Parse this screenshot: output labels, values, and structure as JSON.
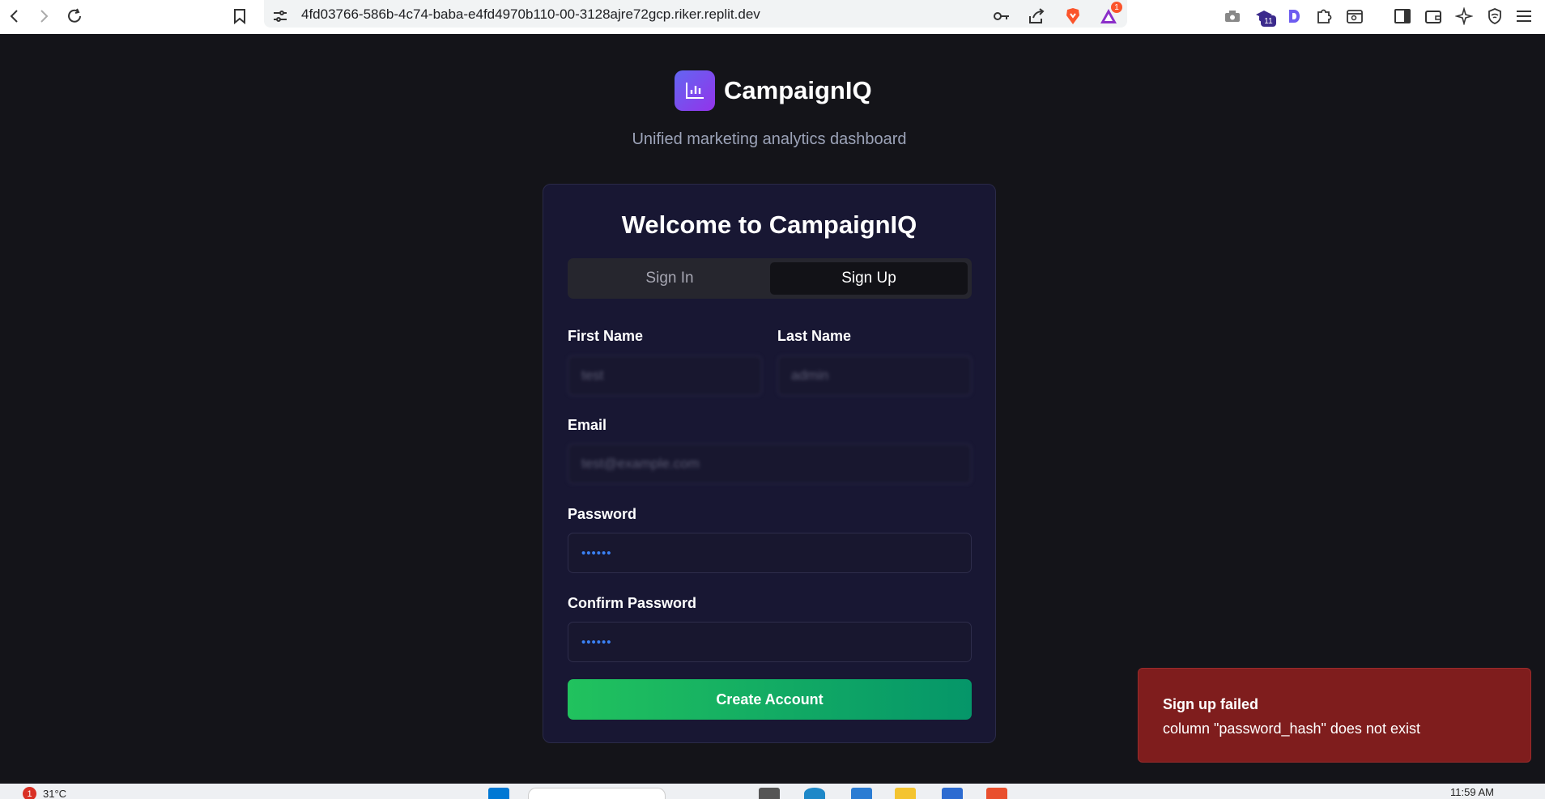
{
  "browser": {
    "url": "4fd03766-586b-4c74-baba-e4fd4970b110-00-3128ajre72gcp.riker.replit.dev",
    "icons": [
      "back-icon",
      "forward-icon",
      "reload-icon",
      "bookmark-icon",
      "site-settings-icon",
      "key-icon",
      "share-icon",
      "brave-shield-icon",
      "brave-rewards-icon",
      "camera-icon",
      "extension-graduate-icon",
      "extension-d-icon",
      "extensions-puzzle-icon",
      "reader-icon",
      "sidebar-icon",
      "wallet-icon",
      "leo-ai-icon",
      "vpn-icon",
      "menu-icon"
    ],
    "rewards_badge": "1",
    "extension_badge": "11"
  },
  "brand": {
    "name": "CampaignIQ",
    "tagline": "Unified marketing analytics dashboard",
    "logo_icon": "bar-chart-icon"
  },
  "auth_card": {
    "title": "Welcome to CampaignIQ",
    "tabs": [
      {
        "label": "Sign In",
        "active": false
      },
      {
        "label": "Sign Up",
        "active": true
      }
    ],
    "fields": {
      "first_name": {
        "label": "First Name",
        "value": "test"
      },
      "last_name": {
        "label": "Last Name",
        "value": "admin"
      },
      "email": {
        "label": "Email",
        "value": "test@example.com"
      },
      "password": {
        "label": "Password",
        "value": "••••••"
      },
      "confirm_password": {
        "label": "Confirm Password",
        "value": "••••••"
      }
    },
    "submit_label": "Create Account"
  },
  "toast": {
    "title": "Sign up failed",
    "message": "column \"password_hash\" does not exist"
  },
  "taskbar": {
    "weather_badge": "1",
    "temperature": "31°C",
    "time": "11:59 AM"
  },
  "colors": {
    "page_bg": "#141419",
    "card_bg": "#181733",
    "accent_gradient_start": "#6366f1",
    "accent_gradient_end": "#9333ea",
    "button_green": "#21c25e",
    "toast_red": "#7f1d1d"
  }
}
